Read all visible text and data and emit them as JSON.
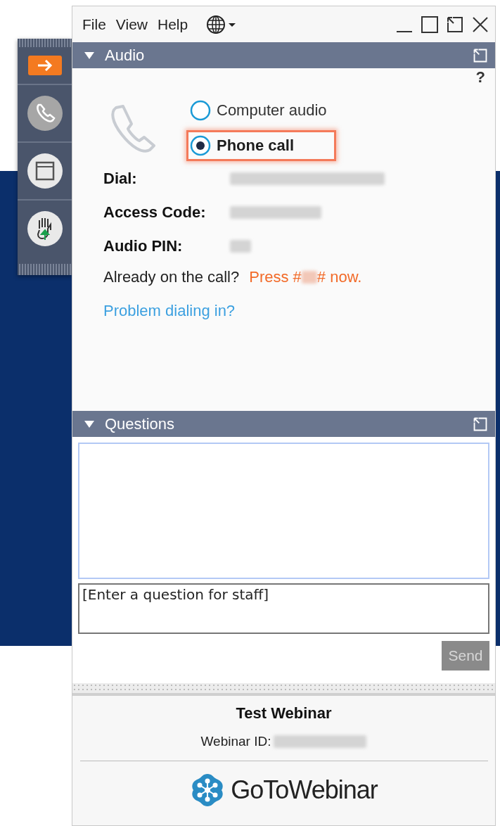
{
  "menu": [
    "File",
    "View",
    "Help"
  ],
  "audio": {
    "title": "Audio",
    "expanded": true,
    "help": "?",
    "options": [
      {
        "label": "Computer audio",
        "selected": false,
        "highlighted": false
      },
      {
        "label": "Phone call",
        "selected": true,
        "highlighted": true
      }
    ],
    "fields": [
      {
        "label": "Dial:"
      },
      {
        "label": "Access Code:"
      },
      {
        "label": "Audio PIN:"
      }
    ],
    "already": "Already on the call?",
    "press_before": "Press #",
    "press_after": "# now.",
    "link": "Problem dialing in?"
  },
  "questions": {
    "title": "Questions",
    "expanded": true,
    "placeholder": "[Enter a question for staff]",
    "send": "Send",
    "send_disabled": true
  },
  "footer": {
    "title": "Test Webinar",
    "id_label": "Webinar ID:",
    "logo": "**GoTo**Webinar"
  }
}
